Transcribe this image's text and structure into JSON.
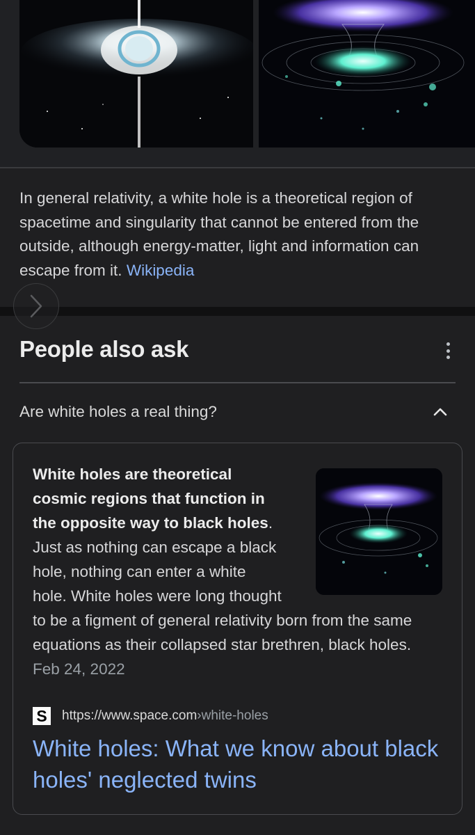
{
  "images": {
    "left_icon": "white-hole-artwork-image",
    "right_icon": "wormhole-funnel-image"
  },
  "description": {
    "text": "In general relativity, a white hole is a theoretical region of spacetime and singularity that cannot be entered from the outside, although energy-matter, light and information can escape from it.",
    "source_link": "Wikipedia"
  },
  "carousel": {
    "icon": "chevron-right-icon"
  },
  "people_also_ask": {
    "title": "People also ask",
    "menu_icon": "more-vert-icon",
    "question": "Are white holes a real thing?",
    "expand_icon": "chevron-up-icon",
    "answer": {
      "bold_text": "White holes are theoretical cosmic regions that function in the opposite way to black holes",
      "bold_end": ".",
      "body_text": " Just as nothing can escape a black hole, nothing can enter a white hole. White holes were long thought to be a figment of general relativity born from the same equations as their collapsed star brethren, black holes.",
      "date": "Feb 24, 2022",
      "thumbnail_icon": "wormhole-thumbnail-image"
    },
    "source": {
      "favicon_letter": "S",
      "url": "https://www.space.com",
      "separator": " › ",
      "path": "white-holes",
      "title": "White holes: What we know about black holes' neglected twins"
    }
  }
}
